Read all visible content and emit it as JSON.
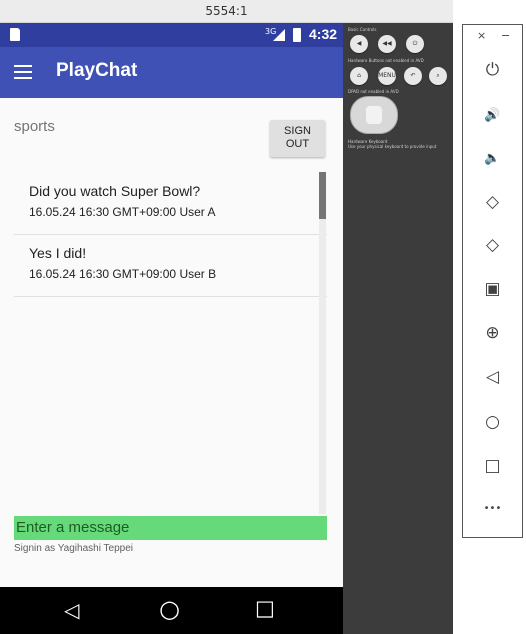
{
  "window": {
    "title": "5554:1"
  },
  "status_bar": {
    "network": "3G",
    "time": "4:32"
  },
  "app_bar": {
    "title": "PlayChat"
  },
  "channel": {
    "name": "sports"
  },
  "signout": {
    "label": "SIGN OUT"
  },
  "messages": [
    {
      "text": "Did you watch Super Bowl?",
      "meta": "16.05.24 16:30 GMT+09:00 User A"
    },
    {
      "text": "Yes I did!",
      "meta": "16.05.24 16:30 GMT+09:00 User B"
    }
  ],
  "input": {
    "placeholder": "Enter a message"
  },
  "footer": {
    "signin": "Signin as Yagihashi Teppei"
  },
  "nav_bar": {
    "back": "◁",
    "home": "○",
    "recents": "□"
  },
  "controls": {
    "basic_label": "Basic Controls",
    "hw_label": "Hardware Buttons not enabled in AVD",
    "dpad_label": "DPAD not enabled in AVD",
    "keyboard_label": "Hardware Keyboard",
    "keyboard_hint": "Use your physical keyboard to provide input",
    "menu_label": "MENU"
  },
  "side_toolbar": {
    "close": "×",
    "minimize": "−",
    "buttons": [
      "power-icon",
      "volume-up-icon",
      "volume-down-icon",
      "rotate-left-icon",
      "rotate-right-icon",
      "camera-icon",
      "zoom-icon",
      "back-icon",
      "home-icon",
      "overview-icon",
      "more-icon"
    ],
    "glyphs": {
      "power": "⏻",
      "vol_up": "🔊",
      "vol_down": "🔈",
      "rot_left": "◇",
      "rot_right": "◇",
      "camera": "▣",
      "zoom": "⊕",
      "back": "◁",
      "home": "○",
      "overview": "□",
      "more": "•••"
    }
  },
  "colors": {
    "primary_dark": "#303f9f",
    "primary": "#3f51b5",
    "input_bg": "#66d97a",
    "controls_bg": "#3c3c3c"
  }
}
